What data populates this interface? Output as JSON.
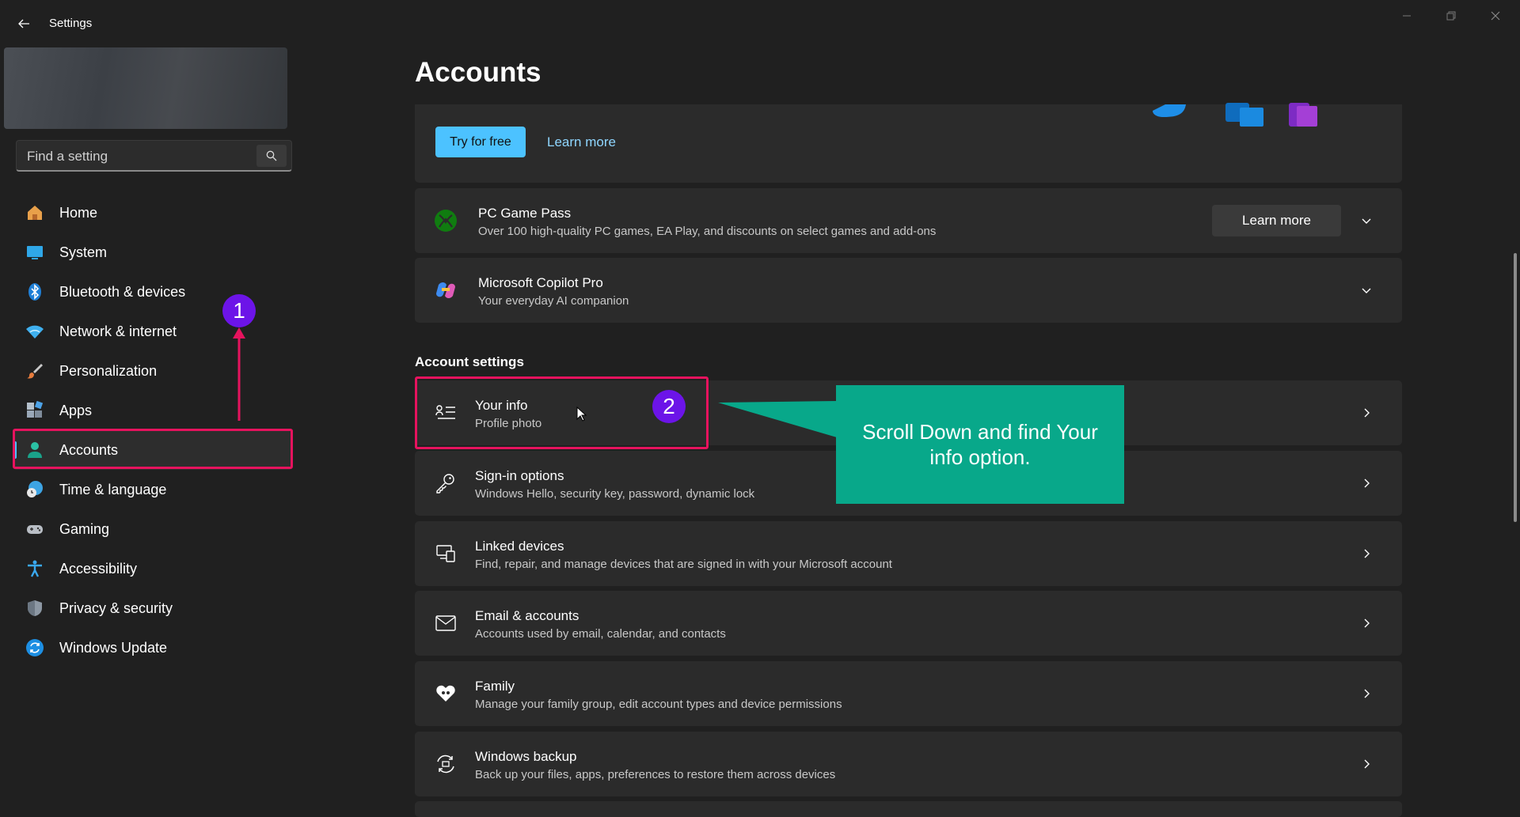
{
  "window": {
    "title": "Settings",
    "controls": [
      "minimize-icon",
      "restore-icon",
      "close-icon"
    ]
  },
  "sidebar": {
    "search": {
      "placeholder": "Find a setting"
    },
    "items": [
      {
        "label": "Home",
        "icon": "home-icon"
      },
      {
        "label": "System",
        "icon": "system-icon"
      },
      {
        "label": "Bluetooth & devices",
        "icon": "bluetooth-icon"
      },
      {
        "label": "Network & internet",
        "icon": "wifi-icon"
      },
      {
        "label": "Personalization",
        "icon": "brush-icon"
      },
      {
        "label": "Apps",
        "icon": "apps-icon"
      },
      {
        "label": "Accounts",
        "icon": "person-icon",
        "selected": true
      },
      {
        "label": "Time & language",
        "icon": "globe-clock-icon"
      },
      {
        "label": "Gaming",
        "icon": "gamepad-icon"
      },
      {
        "label": "Accessibility",
        "icon": "accessibility-icon"
      },
      {
        "label": "Privacy & security",
        "icon": "shield-icon"
      },
      {
        "label": "Windows Update",
        "icon": "update-icon"
      }
    ]
  },
  "main": {
    "title": "Accounts",
    "promo": {
      "primary_button": "Try for free",
      "link": "Learn more"
    },
    "game_pass": {
      "title": "PC Game Pass",
      "subtitle": "Over 100 high-quality PC games, EA Play, and discounts on select games and add-ons",
      "button": "Learn more"
    },
    "copilot": {
      "title": "Microsoft Copilot Pro",
      "subtitle": "Your everyday AI companion"
    },
    "section_header": "Account settings",
    "settings": [
      {
        "title": "Your info",
        "subtitle": "Profile photo",
        "icon": "your-info-icon"
      },
      {
        "title": "Sign-in options",
        "subtitle": "Windows Hello, security key, password, dynamic lock",
        "icon": "key-icon"
      },
      {
        "title": "Linked devices",
        "subtitle": "Find, repair, and manage devices that are signed in with your Microsoft account",
        "icon": "linked-devices-icon"
      },
      {
        "title": "Email & accounts",
        "subtitle": "Accounts used by email, calendar, and contacts",
        "icon": "mail-icon"
      },
      {
        "title": "Family",
        "subtitle": "Manage your family group, edit account types and device permissions",
        "icon": "family-heart-icon"
      },
      {
        "title": "Windows backup",
        "subtitle": "Back up your files, apps, preferences to restore them across devices",
        "icon": "backup-icon"
      }
    ]
  },
  "annotations": {
    "step1": "1",
    "step2": "2",
    "callout": "Scroll Down and find Your info option.",
    "highlight_color": "#e6135e",
    "badge_color": "#6c14e8",
    "callout_color": "#08a88a"
  },
  "colors": {
    "accent": "#4cc2ff",
    "background": "#202020",
    "card": "#2b2b2b"
  }
}
